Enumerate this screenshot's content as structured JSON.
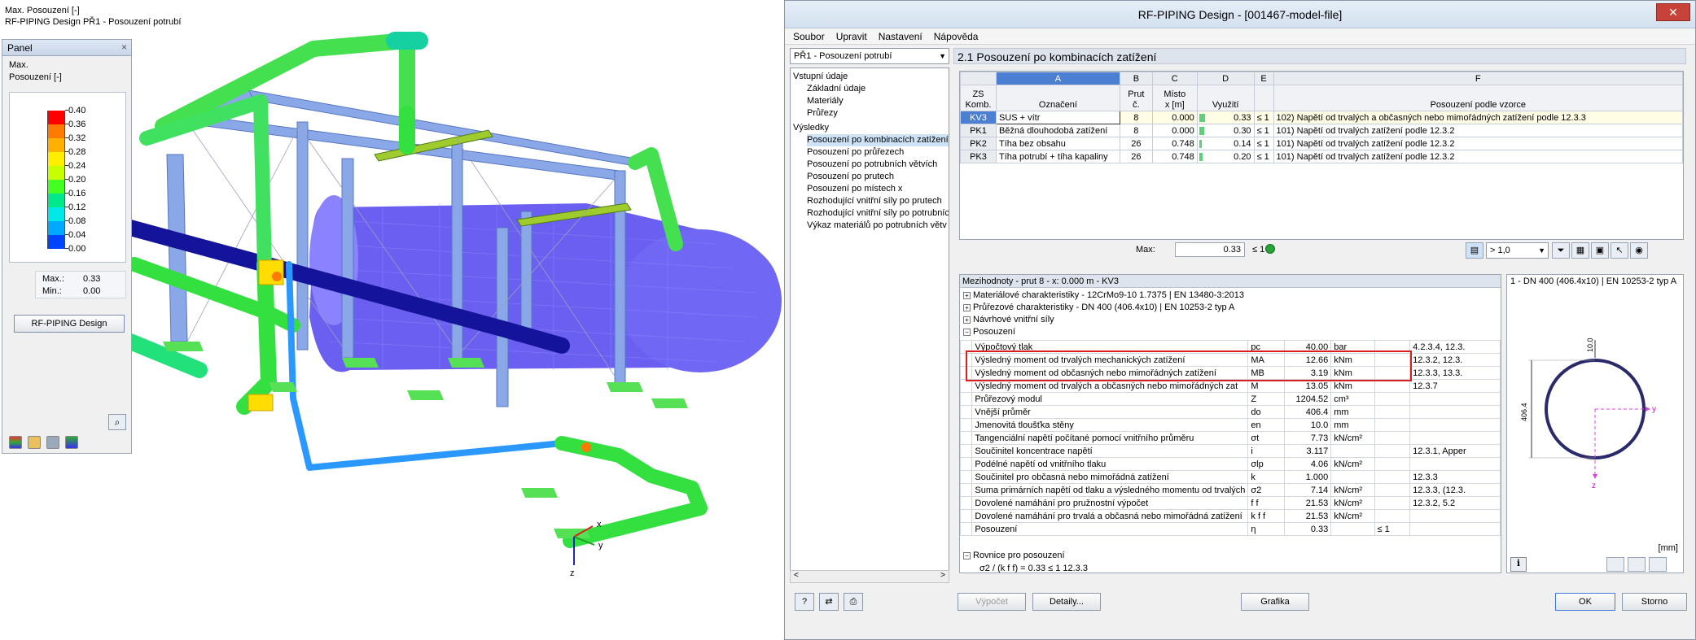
{
  "viewport": {
    "title_line1": "Max. Posouzení [-]",
    "title_line2": "RF-PIPING Design PŘ1 - Posouzení potrubí",
    "axis_x": "x",
    "axis_y": "y",
    "axis_z": "z"
  },
  "panel": {
    "title": "Panel",
    "close": "×",
    "line1": "Max.",
    "line2": "Posouzení [-]",
    "legend": [
      {
        "label": "0.40",
        "color": "#ff0000"
      },
      {
        "label": "0.36",
        "color": "#ff7a00"
      },
      {
        "label": "0.32",
        "color": "#ffb000"
      },
      {
        "label": "0.28",
        "color": "#ffee00"
      },
      {
        "label": "0.24",
        "color": "#c8ff00"
      },
      {
        "label": "0.20",
        "color": "#44ff22"
      },
      {
        "label": "0.16",
        "color": "#00e88a"
      },
      {
        "label": "0.12",
        "color": "#00e8e8"
      },
      {
        "label": "0.08",
        "color": "#00a8ff"
      },
      {
        "label": "0.04",
        "color": "#0044ff"
      },
      {
        "label": "0.00",
        "color": "#0000a8"
      }
    ],
    "max_label": "Max.:",
    "max_value": "0.33",
    "min_label": "Min.:",
    "min_value": "0.00",
    "button": "RF-PIPING Design"
  },
  "dialog": {
    "title": "RF-PIPING Design - [001467-model-file]",
    "close": "✕",
    "menu": [
      "Soubor",
      "Upravit",
      "Nastavení",
      "Nápověda"
    ],
    "combo": "PŘ1 - Posouzení potrubí",
    "tree": {
      "input": "Vstupní údaje",
      "input_items": [
        "Základní údaje",
        "Materiály",
        "Průřezy"
      ],
      "results": "Výsledky",
      "result_items": [
        "Posouzení po kombinacích zatížení",
        "Posouzení po průřezech",
        "Posouzení po potrubních větvích",
        "Posouzení po prutech",
        "Posouzení po místech x",
        "Rozhodující vnitřní síly po prutech",
        "Rozhodující vnitřní síly po potrubníc",
        "Výkaz materiálů po potrubních větv"
      ]
    },
    "section_title": "2.1 Posouzení po kombinacích zatížení",
    "table": {
      "letters": [
        "A",
        "B",
        "C",
        "D",
        "E",
        "F"
      ],
      "h_zs": "ZS\nKomb.",
      "h_a": "Označení",
      "h_b": "Prut\nč.",
      "h_c": "Místo\nx [m]",
      "h_d": "Využití",
      "h_e": "",
      "h_f": "Posouzení podle vzorce",
      "rows": [
        {
          "zs": "KV3",
          "name": "SUS + vítr",
          "member": "8",
          "x": "0.000",
          "ratio": 0.33,
          "ratio_txt": "0.33",
          "le": "≤ 1",
          "formula": "102) Napětí od trvalých a občasných nebo mimořádných zatížení podle 12.3.3"
        },
        {
          "zs": "PK1",
          "name": "Běžná dlouhodobá zatížení",
          "member": "8",
          "x": "0.000",
          "ratio": 0.3,
          "ratio_txt": "0.30",
          "le": "≤ 1",
          "formula": "101) Napětí od trvalých zatížení podle 12.3.2"
        },
        {
          "zs": "PK2",
          "name": "Tíha bez obsahu",
          "member": "26",
          "x": "0.748",
          "ratio": 0.14,
          "ratio_txt": "0.14",
          "le": "≤ 1",
          "formula": "101) Napětí od trvalých zatížení podle 12.3.2"
        },
        {
          "zs": "PK3",
          "name": "Tíha potrubí + tíha kapaliny",
          "member": "26",
          "x": "0.748",
          "ratio": 0.2,
          "ratio_txt": "0.20",
          "le": "≤ 1",
          "formula": "101) Napětí od trvalých zatížení podle 12.3.2"
        }
      ]
    },
    "max": {
      "label": "Max:",
      "value": "0.33",
      "le": "≤ 1"
    },
    "filter": "> 1,0",
    "details": {
      "header": "Mezihodnoty - prut 8 - x: 0.000 m - KV3",
      "groups": [
        "Materiálové charakteristiky - 12CrMo9-10 1.7375 | EN 13480-3:2013",
        "Průřezové charakteristiky - DN 400 (406.4x10) | EN 10253-2 typ A",
        "Návrhové vnitřní síly",
        "Posouzení"
      ],
      "rows": [
        {
          "name": "Výpočtový tlak",
          "sym": "pc",
          "val": "40.00",
          "unit": "bar",
          "ref": "4.2.3.4, 12.3."
        },
        {
          "name": "Výsledný moment od trvalých mechanických zatížení",
          "sym": "MA",
          "val": "12.66",
          "unit": "kNm",
          "ref": "12.3.2, 12.3."
        },
        {
          "name": "Výsledný moment od občasných nebo mimořádných zatížení",
          "sym": "MB",
          "val": "3.19",
          "unit": "kNm",
          "ref": "12.3.3, 13.3."
        },
        {
          "name": "Výsledný moment od trvalých a občasných nebo mimořádných zat",
          "sym": "M",
          "val": "13.05",
          "unit": "kNm",
          "ref": "12.3.7"
        },
        {
          "name": "Průřezový modul",
          "sym": "Z",
          "val": "1204.52",
          "unit": "cm³",
          "ref": ""
        },
        {
          "name": "Vnější průměr",
          "sym": "do",
          "val": "406.4",
          "unit": "mm",
          "ref": ""
        },
        {
          "name": "Jmenovitá tloušťka stěny",
          "sym": "en",
          "val": "10.0",
          "unit": "mm",
          "ref": ""
        },
        {
          "name": "Tangenciální napětí počítané pomocí vnitřního průměru",
          "sym": "σt",
          "val": "7.73",
          "unit": "kN/cm²",
          "ref": ""
        },
        {
          "name": "Součinitel koncentrace napětí",
          "sym": "i",
          "val": "3.117",
          "unit": "",
          "ref": "12.3.1, Apper"
        },
        {
          "name": "Podélné napětí od vnitřního tlaku",
          "sym": "σlp",
          "val": "4.06",
          "unit": "kN/cm²",
          "ref": ""
        },
        {
          "name": "Součinitel pro občasná nebo mimořádná zatížení",
          "sym": "k",
          "val": "1.000",
          "unit": "",
          "ref": "12.3.3"
        },
        {
          "name": "Suma primárních napětí od tlaku a výsledného momentu od trvalých",
          "sym": "σ2",
          "val": "7.14",
          "unit": "kN/cm²",
          "ref": "12.3.3, (12.3."
        },
        {
          "name": "Dovolené namáhání pro pružnostní výpočet",
          "sym": "f f",
          "val": "21.53",
          "unit": "kN/cm²",
          "ref": "12.3.2, 5.2"
        },
        {
          "name": "Dovolené namáhání pro trvalá a občasná nebo mimořádná zatížení",
          "sym": "k f f",
          "val": "21.53",
          "unit": "kN/cm²",
          "ref": ""
        },
        {
          "name": "Posouzení",
          "sym": "η",
          "val": "0.33",
          "unit": "≤ 1",
          "ref": ""
        }
      ],
      "eq_group": "Rovnice pro posouzení",
      "eq_text": "σ2 / (k f f) = 0.33 ≤ 1    12.3.3"
    },
    "cross_section": {
      "title": "1 - DN 400 (406.4x10) | EN 10253-2 typ A",
      "dim_thk": "10.0",
      "dim_dia": "406.4",
      "axis_y": "y",
      "axis_z": "z",
      "unit": "[mm]"
    },
    "buttons": {
      "calc": "Výpočet",
      "details": "Detaily...",
      "graphics": "Grafika",
      "ok": "OK",
      "cancel": "Storno"
    }
  }
}
